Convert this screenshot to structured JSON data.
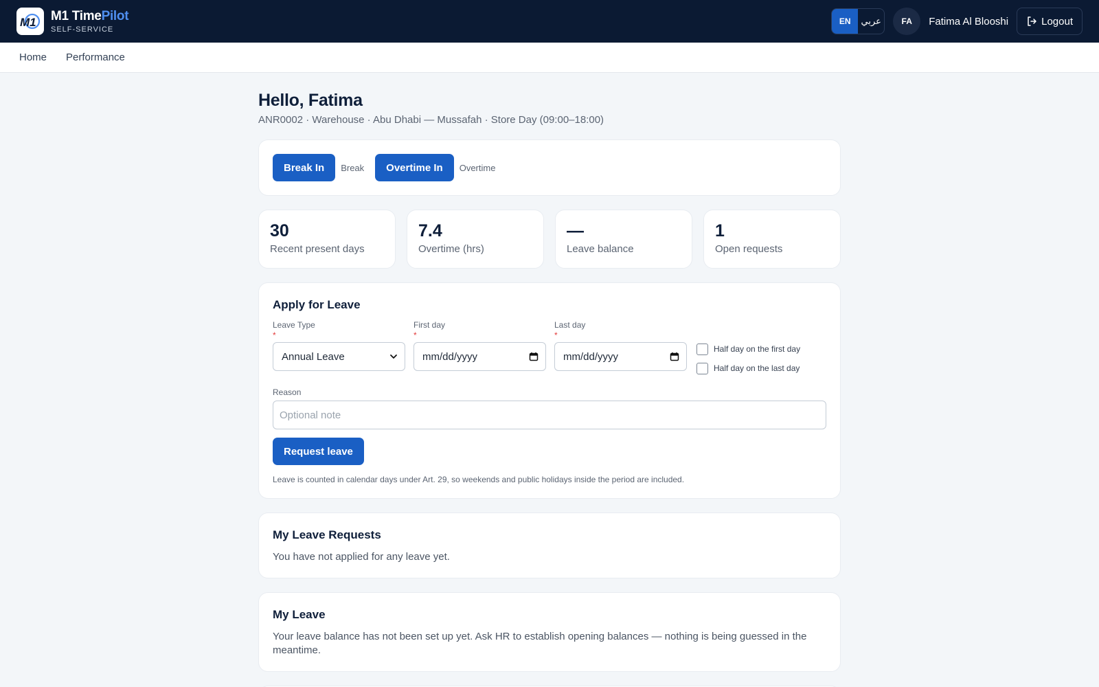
{
  "brand": {
    "title_main": "M1 Time",
    "title_accent": "Pilot",
    "subtitle": "SELF-SERVICE",
    "logo_text": "M1"
  },
  "header": {
    "lang_en": "EN",
    "lang_ar": "عربي",
    "avatar_initials": "FA",
    "user_name": "Fatima Al Blooshi",
    "logout_label": "Logout"
  },
  "nav": {
    "items": [
      "Home",
      "Performance"
    ]
  },
  "greeting": {
    "title": "Hello, Fatima",
    "subtitle": "ANR0002 · Warehouse · Abu Dhabi — Mussafah · Store Day (09:00–18:00)"
  },
  "actions": {
    "break_button": "Break In",
    "break_label": "Break",
    "overtime_button": "Overtime In",
    "overtime_label": "Overtime"
  },
  "stats": [
    {
      "value": "30",
      "label": "Recent present days"
    },
    {
      "value": "7.4",
      "label": "Overtime (hrs)"
    },
    {
      "value": "—",
      "label": "Leave balance"
    },
    {
      "value": "1",
      "label": "Open requests"
    }
  ],
  "leave_form": {
    "title": "Apply for Leave",
    "leave_type_label": "Leave Type",
    "leave_type_value": "Annual Leave",
    "first_day_label": "First day",
    "first_day_value": "mm/dd/yyyy",
    "last_day_label": "Last day",
    "last_day_value": "mm/dd/yyyy",
    "required_mark": "*",
    "half_first": "Half day on the first day",
    "half_last": "Half day on the last day",
    "reason_label": "Reason",
    "reason_placeholder": "Optional note",
    "submit": "Request leave",
    "note": "Leave is counted in calendar days under Art. 29, so weekends and public holidays inside the period are included."
  },
  "my_requests": {
    "title": "My Leave Requests",
    "empty": "You have not applied for any leave yet."
  },
  "my_leave": {
    "title": "My Leave",
    "message": "Your leave balance has not been set up yet. Ask HR to establish opening balances — nothing is being guessed in the meantime."
  },
  "colors": {
    "header_bg": "#0b1a33",
    "primary": "#1a5fc4",
    "accent": "#4f8ff0",
    "required": "#e23b3b"
  }
}
